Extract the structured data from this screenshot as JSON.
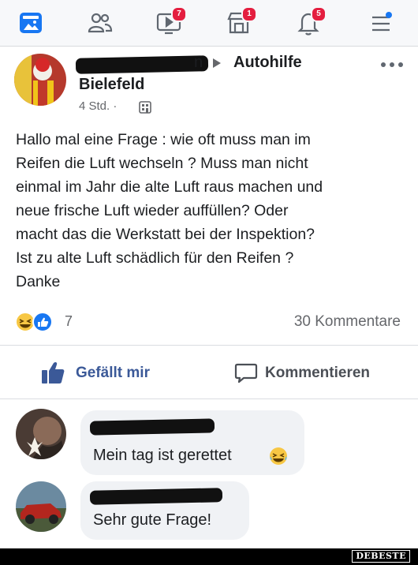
{
  "nav": {
    "badges": {
      "video": "7",
      "marketplace": "1",
      "notifications": "5"
    }
  },
  "post": {
    "author_suffix": "n",
    "group": "Autohilfe",
    "city": "Bielefeld",
    "time": "4 Std. ·",
    "body_lines": [
      "Hallo mal eine Frage : wie oft muss man im",
      "Reifen die Luft wechseln ? Muss man nicht",
      "einmal im Jahr die alte Luft raus machen und",
      "neue frische Luft wieder auffüllen? Oder",
      "macht das die Werkstatt bei der Inspektion?",
      "Ist zu alte Luft schädlich für den Reifen ?",
      "Danke"
    ],
    "reaction_count": "7",
    "comments_count": "30 Kommentare",
    "like_label": "Gefällt mir",
    "comment_label": "Kommentieren"
  },
  "comments": [
    {
      "text": "Mein tag ist gerettet"
    },
    {
      "text": "Sehr gute Frage!"
    }
  ],
  "watermark": "DEBESTE",
  "colors": {
    "accent": "#3b5998",
    "badge": "#e41e3f",
    "bubble": "#f0f2f5"
  }
}
